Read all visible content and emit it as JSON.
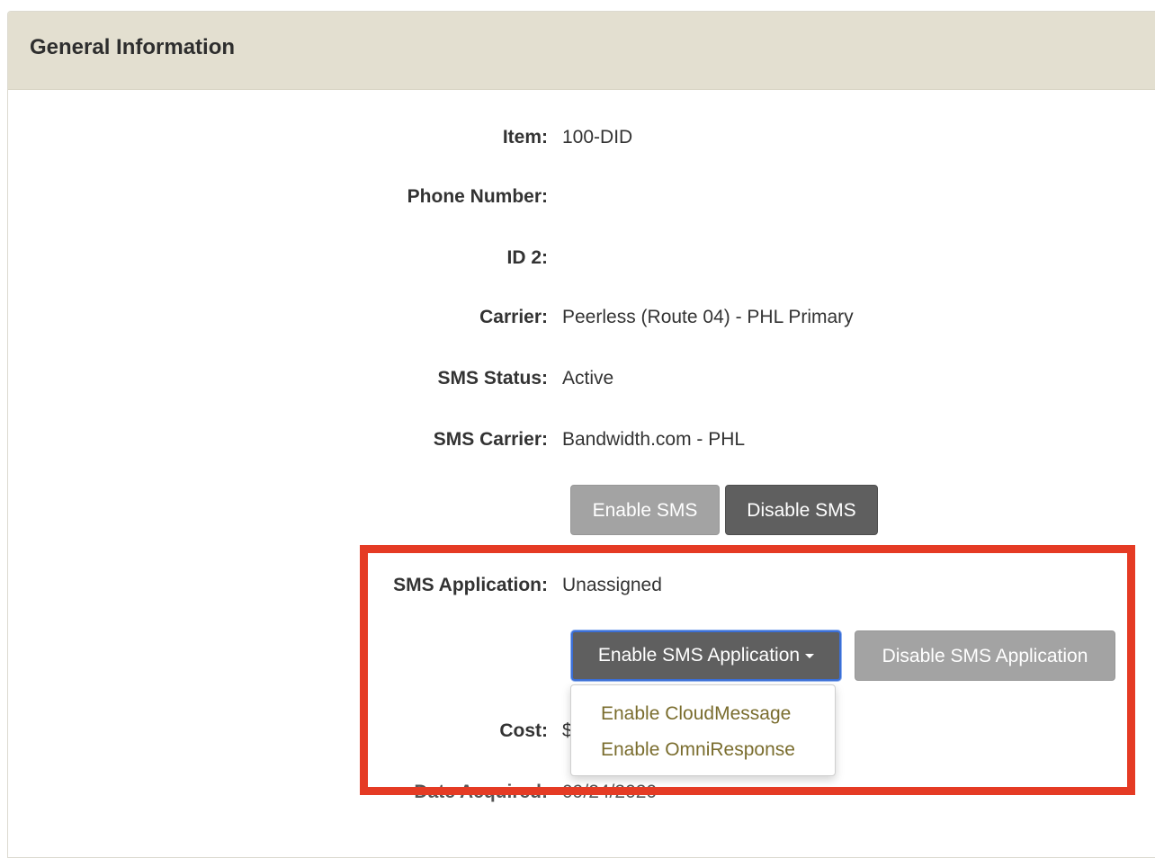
{
  "panel": {
    "title": "General Information"
  },
  "fields": {
    "item": {
      "label": "Item:",
      "value": "100-DID"
    },
    "phone_number": {
      "label": "Phone Number:",
      "value": ""
    },
    "id2": {
      "label": "ID 2:",
      "value": ""
    },
    "carrier": {
      "label": "Carrier:",
      "value": "Peerless (Route 04) - PHL Primary"
    },
    "sms_status": {
      "label": "SMS Status:",
      "value": "Active"
    },
    "sms_carrier": {
      "label": "SMS Carrier:",
      "value": "Bandwidth.com - PHL"
    },
    "sms_application": {
      "label": "SMS Application:",
      "value": "Unassigned"
    },
    "cost": {
      "label": "Cost:",
      "value": "$"
    },
    "date_acquired": {
      "label": "Date Acquired:",
      "value": "09/24/2020"
    }
  },
  "sms_buttons": {
    "enable": "Enable SMS",
    "disable": "Disable SMS"
  },
  "sms_app_buttons": {
    "enable": "Enable SMS Application",
    "disable": "Disable SMS Application"
  },
  "dropdown": {
    "items": [
      "Enable CloudMessage",
      "Enable OmniResponse"
    ]
  },
  "colors": {
    "header_bg": "#e3dfd0",
    "highlight": "#e53b24",
    "link": "#7a6d2e",
    "focus_ring": "#3b6fd6"
  },
  "icons": {
    "dropdown_caret": "caret-down-icon"
  }
}
